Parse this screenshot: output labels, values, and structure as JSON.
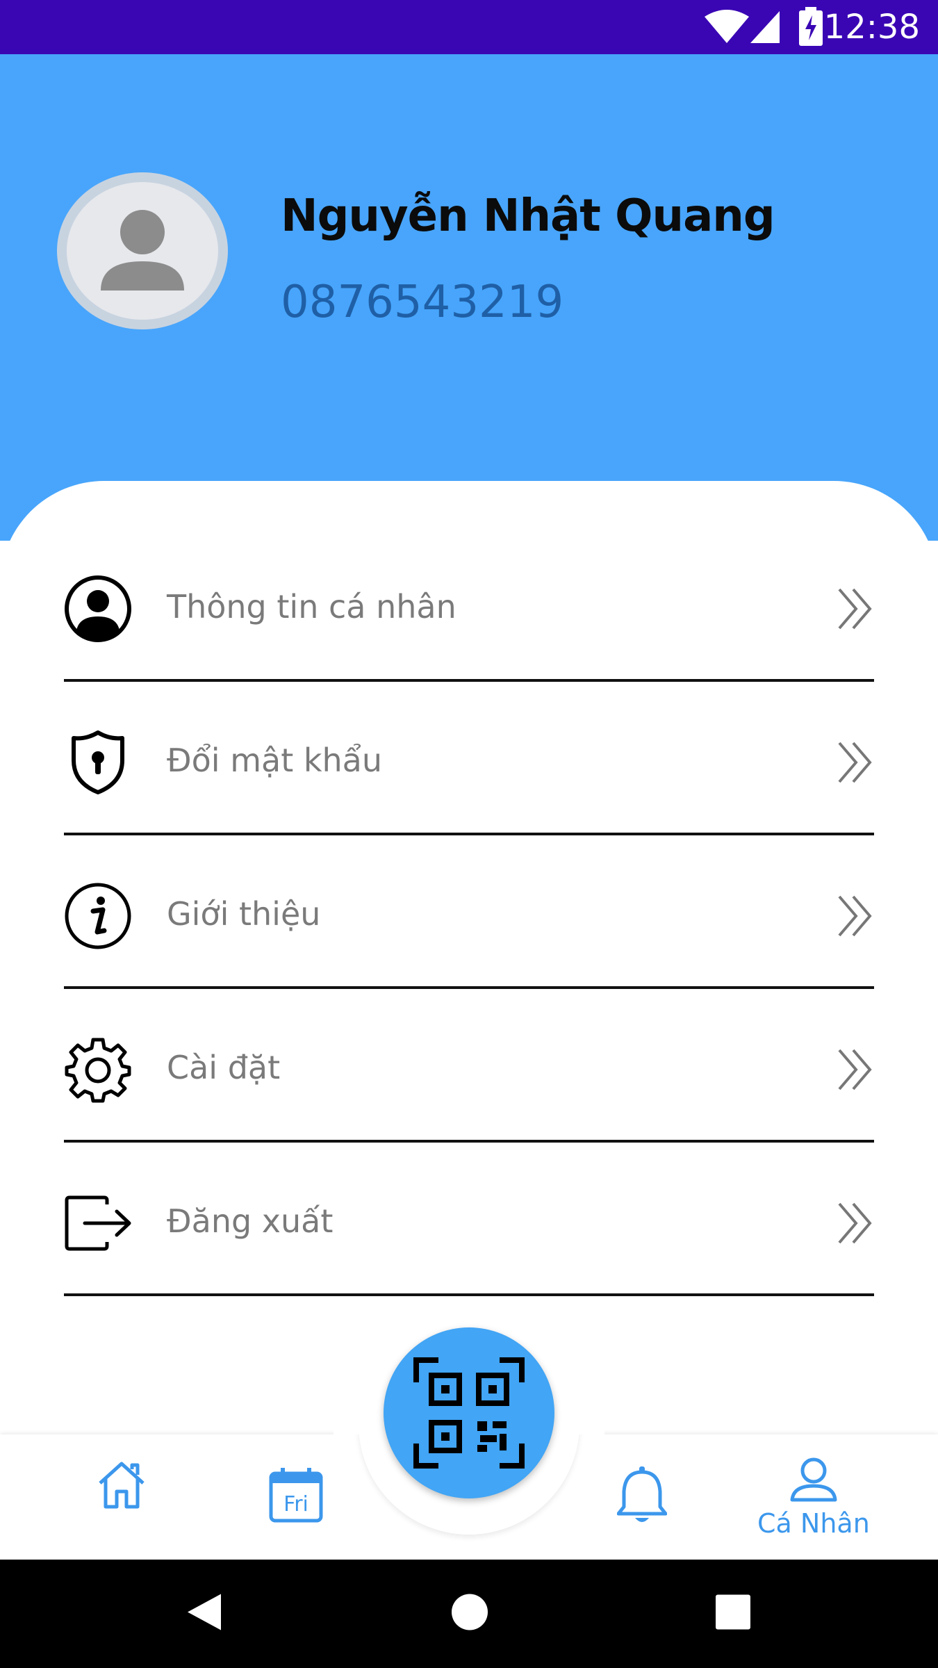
{
  "status_bar": {
    "time": "12:38",
    "background": "#3a06b4"
  },
  "profile": {
    "name": "Nguyễn Nhật Quang",
    "phone": "0876543219",
    "header_color": "#48a5fb"
  },
  "menu": {
    "items": [
      {
        "id": "personal-info",
        "label": "Thông tin cá nhân",
        "icon": "user-circle-icon"
      },
      {
        "id": "change-password",
        "label": "Đổi mật khẩu",
        "icon": "shield-lock-icon"
      },
      {
        "id": "about",
        "label": "Giới thiệu",
        "icon": "info-icon"
      },
      {
        "id": "settings",
        "label": "Cài đặt",
        "icon": "gear-icon"
      },
      {
        "id": "logout",
        "label": "Đăng xuất",
        "icon": "logout-icon"
      }
    ],
    "chevron_icon": "double-chevron-right-icon"
  },
  "bottom_nav": {
    "items": [
      {
        "id": "home",
        "icon": "home-icon"
      },
      {
        "id": "calendar",
        "icon": "calendar-icon",
        "calendar_text": "Fri"
      },
      {
        "id": "notifications",
        "icon": "bell-icon"
      },
      {
        "id": "profile",
        "icon": "person-icon",
        "label": "Cá Nhân"
      }
    ],
    "center_button_icon": "qr-code-icon",
    "accent": "#42a5f5"
  },
  "system_nav": {
    "back": "back-icon",
    "home": "home-circle-icon",
    "recents": "recents-icon"
  }
}
